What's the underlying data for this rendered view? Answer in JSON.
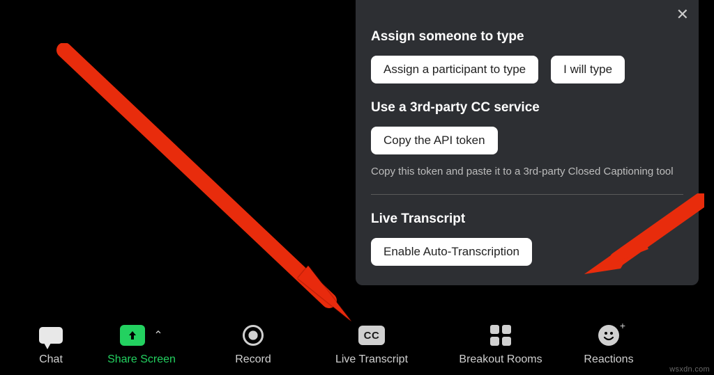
{
  "popover": {
    "section1_title": "Assign someone to type",
    "assign_label": "Assign a participant to type",
    "i_will_type_label": "I will type",
    "section2_title": "Use a 3rd-party CC service",
    "copy_token_label": "Copy the API token",
    "helper_text": "Copy this token and paste it to a 3rd-party Closed Captioning tool",
    "section3_title": "Live Transcript",
    "enable_auto_label": "Enable Auto-Transcription"
  },
  "toolbar": {
    "chat_label": "Chat",
    "share_label": "Share Screen",
    "record_label": "Record",
    "transcript_label": "Live Transcript",
    "breakout_label": "Breakout Rooms",
    "reactions_label": "Reactions",
    "cc_text": "CC"
  },
  "watermark": "wsxdn.com"
}
